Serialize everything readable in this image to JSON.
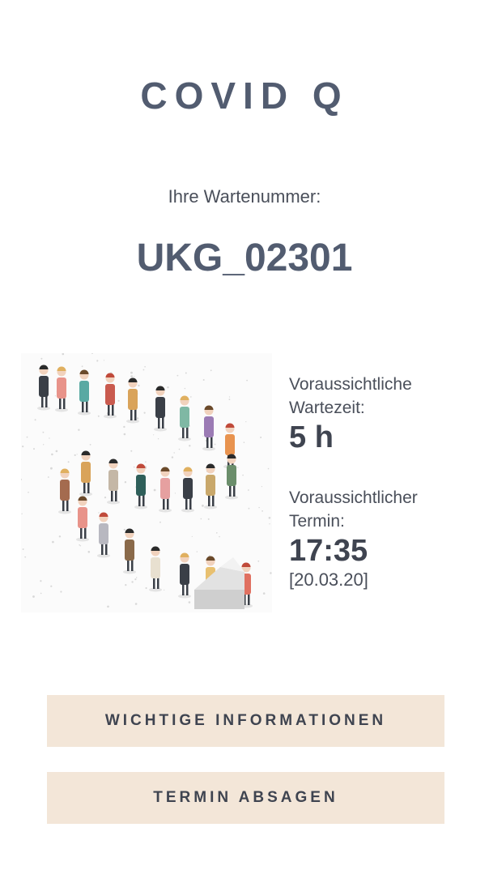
{
  "header": {
    "title": "COVID Q"
  },
  "queue": {
    "label": "Ihre Wartenummer:",
    "number": "UKG_02301"
  },
  "illustration": {
    "icon": "queue-people-illustration"
  },
  "wait_time": {
    "label": "Voraussichtliche Wartezeit:",
    "value": "5 h"
  },
  "appointment": {
    "label": "Voraussichtlicher Termin:",
    "time": "17:35",
    "date": "[20.03.20]"
  },
  "buttons": {
    "info_label": "WICHTIGE INFORMATIONEN",
    "cancel_label": "TERMIN  ABSAGEN",
    "background": "#f3e6d8"
  },
  "colors": {
    "title": "#525c70",
    "text": "#4a4f5a"
  }
}
